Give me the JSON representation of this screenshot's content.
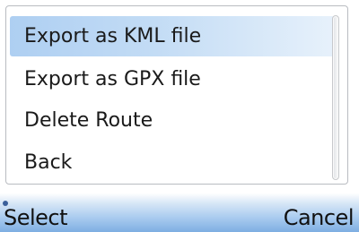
{
  "menu": {
    "items": [
      {
        "label": "Export as KML file",
        "selected": true
      },
      {
        "label": "Export as GPX file",
        "selected": false
      },
      {
        "label": "Delete Route",
        "selected": false
      },
      {
        "label": "Back",
        "selected": false
      }
    ]
  },
  "softkeys": {
    "left_label": "Select",
    "right_label": "Cancel"
  },
  "colors": {
    "highlight": "#aecff2",
    "softkey_bar": "#7eaee2"
  }
}
